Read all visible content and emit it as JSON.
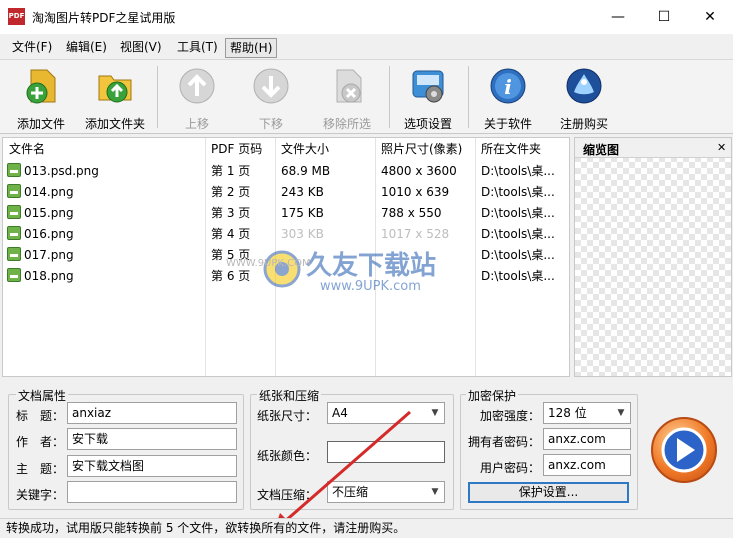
{
  "window": {
    "title": "淘淘图片转PDF之星试用版",
    "app_icon_text": "PDF",
    "min": "—",
    "max": "☐",
    "close": "✕"
  },
  "menu": [
    {
      "label": "文件(F)"
    },
    {
      "label": "编辑(E)"
    },
    {
      "label": "视图(V)"
    },
    {
      "label": "工具(T)"
    },
    {
      "label": "帮助(H)"
    }
  ],
  "toolbar": {
    "add_file": "添加文件",
    "add_folder": "添加文件夹",
    "move_up": "上移",
    "move_down": "下移",
    "remove_selected": "移除所选",
    "options": "选项设置",
    "about": "关于软件",
    "register": "注册购买"
  },
  "table": {
    "headers": {
      "name": "文件名",
      "page": "PDF 页码",
      "size": "文件大小",
      "dims": "照片尺寸(像素)",
      "folder": "所在文件夹"
    },
    "rows": [
      {
        "name": "013.psd.png",
        "page": "第 1 页",
        "size": "68.9 MB",
        "dims": "4800 x 3600",
        "folder": "D:\\tools\\桌..."
      },
      {
        "name": "014.png",
        "page": "第 2 页",
        "size": "243 KB",
        "dims": "1010 x 639",
        "folder": "D:\\tools\\桌..."
      },
      {
        "name": "015.png",
        "page": "第 3 页",
        "size": "175 KB",
        "dims": "788 x 550",
        "folder": "D:\\tools\\桌..."
      },
      {
        "name": "016.png",
        "page": "第 4 页",
        "size": "303 KB",
        "dims": "1017 x 528",
        "folder": "D:\\tools\\桌..."
      },
      {
        "name": "017.png",
        "page": "第 5 页",
        "size": "",
        "dims": "",
        "folder": "D:\\tools\\桌..."
      },
      {
        "name": "018.png",
        "page": "第 6 页",
        "size": "",
        "dims": "",
        "folder": "D:\\tools\\桌..."
      }
    ]
  },
  "preview": {
    "title": "缩览图",
    "close": "✕"
  },
  "watermark": {
    "main": "久友下载站",
    "sub": "www.9UPK.com",
    "small": "WWW.9UPK.COM"
  },
  "doc_props": {
    "title": "文档属性",
    "title_label": "标　题：",
    "title_value": "anxiaz",
    "author_label": "作　者：",
    "author_value": "安下载",
    "subject_label": "主　题：",
    "subject_value": "安下载文档图",
    "keywords_label": "关键字：",
    "keywords_value": ""
  },
  "paper": {
    "title": "纸张和压缩",
    "size_label": "纸张尺寸：",
    "size_value": "A4",
    "color_label": "纸张颜色：",
    "compress_label": "文档压缩：",
    "compress_value": "不压缩"
  },
  "encrypt": {
    "title": "加密保护",
    "strength_label": "加密强度：",
    "strength_value": "128 位",
    "owner_label": "拥有者密码：",
    "owner_value": "anxz.com",
    "user_label": "用户密码：",
    "user_value": "anxz.com",
    "protect_button": "保护设置..."
  },
  "status": "转换成功，试用版只能转换前 5 个文件，欲转换所有的文件，请注册购买。",
  "colors": {
    "arrow": "#d42a2a",
    "accent": "#2f78c4"
  }
}
